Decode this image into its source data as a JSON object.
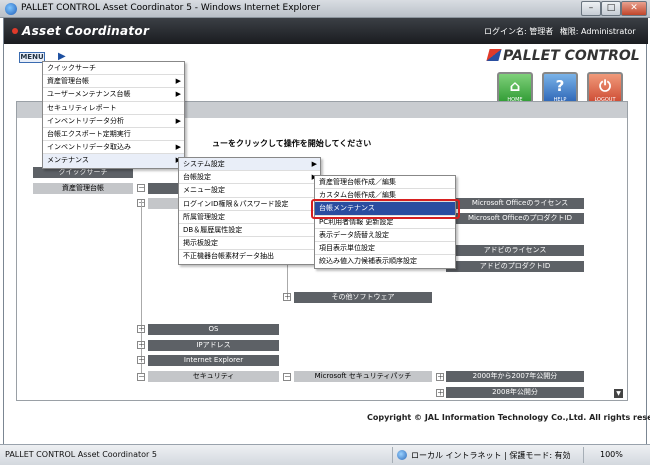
{
  "window": {
    "title": "PALLET CONTROL Asset Coordinator 5 - Windows Internet Explorer",
    "min": "–",
    "max": "□",
    "close": "✕"
  },
  "header": {
    "logo": "Asset Coordinator",
    "login_label": "ログイン名: 管理者",
    "rights_label": "権限: Administrator",
    "brand": "PALLET CONTROL",
    "menu_button": "MENU",
    "menu_arrow": "▶"
  },
  "nav": {
    "home": "HOME",
    "help": "HELP",
    "logout": "LOGOUT"
  },
  "instruction": "ューをクリックして操作を開始してください",
  "menu_l1": {
    "items": [
      {
        "label": "クイックサーチ",
        "sub": ""
      },
      {
        "label": "資産管理台帳",
        "sub": "▶"
      },
      {
        "label": "ユーザーメンテナンス台帳",
        "sub": "▶"
      },
      {
        "label": "セキュリティレポート",
        "sub": ""
      },
      {
        "label": "インベントリデータ分析",
        "sub": "▶"
      },
      {
        "label": "台帳エクスポート定期実行",
        "sub": ""
      },
      {
        "label": "インベントリデータ取込み",
        "sub": "▶"
      },
      {
        "label": "メンテナンス",
        "sub": "▶"
      }
    ]
  },
  "menu_l2": {
    "items": [
      {
        "label": "システム設定",
        "sub": "▶"
      },
      {
        "label": "台帳設定",
        "sub": "▶"
      },
      {
        "label": "メニュー設定",
        "sub": ""
      },
      {
        "label": "ログインID権限＆パスワード設定",
        "sub": ""
      },
      {
        "label": "所属管理設定",
        "sub": ""
      },
      {
        "label": "DB＆履歴属性設定",
        "sub": ""
      },
      {
        "label": "掲示板設定",
        "sub": ""
      },
      {
        "label": "不正機器台帳素材データ抽出",
        "sub": ""
      }
    ]
  },
  "menu_l3": {
    "items": [
      {
        "label": "資産管理台帳作成／編集"
      },
      {
        "label": "カスタム台帳作成／編集"
      },
      {
        "label": "台帳メンテナンス"
      },
      {
        "label": "PC利用者情報 更新設定"
      },
      {
        "label": "表示データ読替え設定"
      },
      {
        "label": "項目表示単位設定"
      },
      {
        "label": "絞込み値入力候補表示順序設定"
      }
    ]
  },
  "tree": {
    "quick_search": "クイックサーチ",
    "asset_ledger": "資産管理台帳",
    "ms_office_license": "Microsoft Officeのライセンス",
    "ms_office_product_id": "Microsoft OfficeのプロダクトID",
    "adobe_license": "アドビのライセンス",
    "adobe_product_id": "アドビのプロダクトID",
    "other_software": "その他ソフトウェア",
    "os": "OS",
    "ip_address": "IPアドレス",
    "internet_explorer": "Internet Explorer",
    "security": "セキュリティ",
    "ms_security_patch": "Microsoft セキュリティパッチ",
    "patch_2000_2007": "2000年から2007年公開分",
    "patch_2008": "2008年公開分",
    "toggle_minus": "－",
    "toggle_plus": "＋"
  },
  "footer": {
    "copyright": "Copyright  ©  JAL Information Technology Co.,Ltd. All rights reserved."
  },
  "statusbar": {
    "text": "PALLET CONTROL Asset Coordinator 5",
    "zone": "ローカル イントラネット | 保護モード: 有効",
    "zoom": "100%"
  },
  "colors": {
    "selected": "#2a4da0",
    "highlight_border": "#d72020",
    "header_bg": "#1a1c20",
    "dark_box": "#5d6166"
  }
}
